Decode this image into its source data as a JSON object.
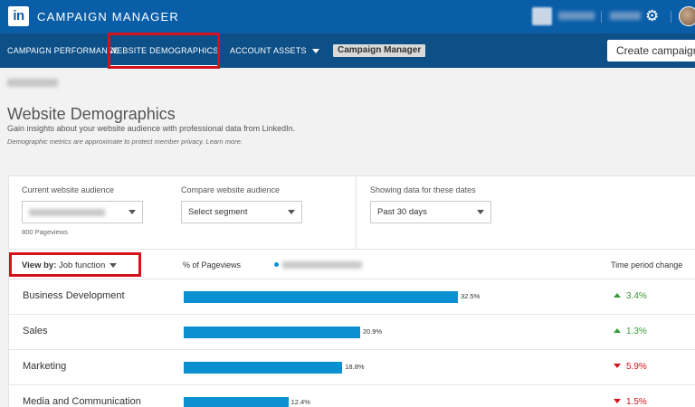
{
  "app": {
    "logo": "in",
    "title": "CAMPAIGN MANAGER"
  },
  "nav": {
    "items": [
      "CAMPAIGN PERFORMANCE",
      "WEBSITE DEMOGRAPHICS",
      "ACCOUNT ASSETS"
    ],
    "badge": "Campaign Manager",
    "create_button": "Create campaign"
  },
  "header": {
    "title": "Website Demographics",
    "subtitle": "Gain insights about your website audience with professional data from LinkedIn.",
    "note": "Demographic metrics are approximate to protect member privacy. Learn more."
  },
  "filters": {
    "current_label": "Current website audience",
    "current_note": "800 Pageviews",
    "compare_label": "Compare website audience",
    "compare_value": "Select segment",
    "dates_label": "Showing data for these dates",
    "dates_value": "Past 30 days"
  },
  "table": {
    "viewby_label": "View by:",
    "viewby_value": "Job function",
    "col_pct": "% of Pageviews",
    "col_change": "Time period change",
    "rows": [
      {
        "label": "Business Development",
        "pct": 32.5,
        "pct_text": "32.5%",
        "change": "3.4%",
        "direction": "up"
      },
      {
        "label": "Sales",
        "pct": 20.9,
        "pct_text": "20.9%",
        "change": "1.3%",
        "direction": "up"
      },
      {
        "label": "Marketing",
        "pct": 18.8,
        "pct_text": "18.8%",
        "change": "5.9%",
        "direction": "down"
      },
      {
        "label": "Media and Communication",
        "pct": 12.4,
        "pct_text": "12.4%",
        "change": "1.5%",
        "direction": "down"
      }
    ]
  },
  "colors": {
    "topbar": "#0a5ea8",
    "navbar": "#0d4f87",
    "bar": "#0a90d0",
    "up": "#3a9a3a",
    "down": "#d4121c",
    "highlight": "#d4121c"
  },
  "icons": [
    "linkedin-logo",
    "gear-icon",
    "avatar",
    "chevron-down-icon",
    "triangle-up-icon",
    "triangle-down-icon"
  ]
}
